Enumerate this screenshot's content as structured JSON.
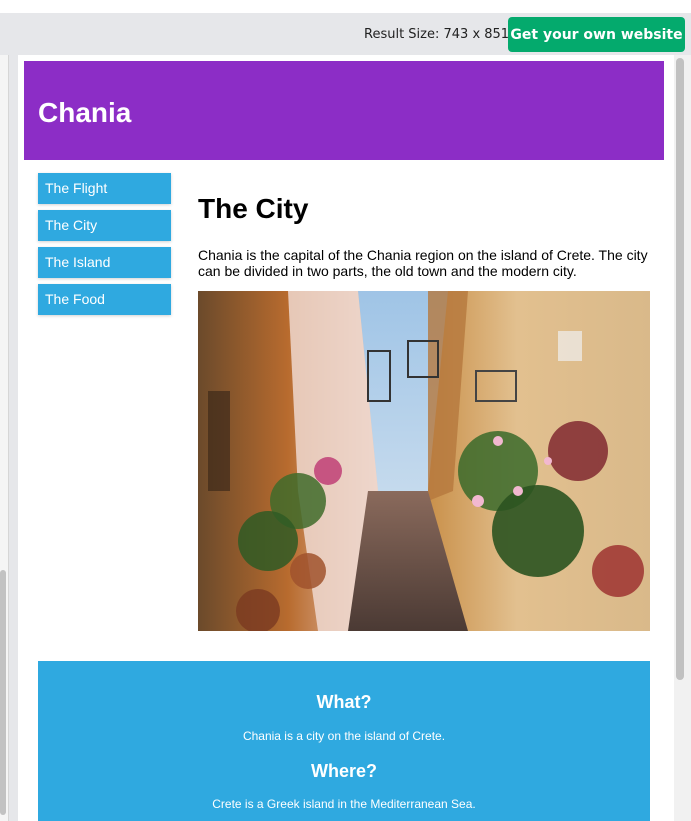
{
  "toolbar": {
    "result_size": "Result Size: 743 x 851",
    "own_website_button": "Get your own website"
  },
  "header": {
    "title": "Chania"
  },
  "menu": {
    "items": [
      {
        "label": "The Flight"
      },
      {
        "label": "The City"
      },
      {
        "label": "The Island"
      },
      {
        "label": "The Food"
      }
    ]
  },
  "main": {
    "heading": "The City",
    "paragraph": "Chania is the capital of the Chania region on the island of Crete. The city can be divided in two parts, the old town and the modern city.",
    "image": {
      "subject": "narrow alley street in Chania"
    }
  },
  "aside": {
    "q1": "What?",
    "a1": "Chania is a city on the island of Crete.",
    "q2": "Where?",
    "a2": "Crete is a Greek island in the Mediterranean Sea."
  },
  "colors": {
    "header_bg": "#8c2dc6",
    "menu_bg": "#2fa9e0",
    "aside_bg": "#2fa9e0",
    "button_bg": "#04aa6d"
  }
}
